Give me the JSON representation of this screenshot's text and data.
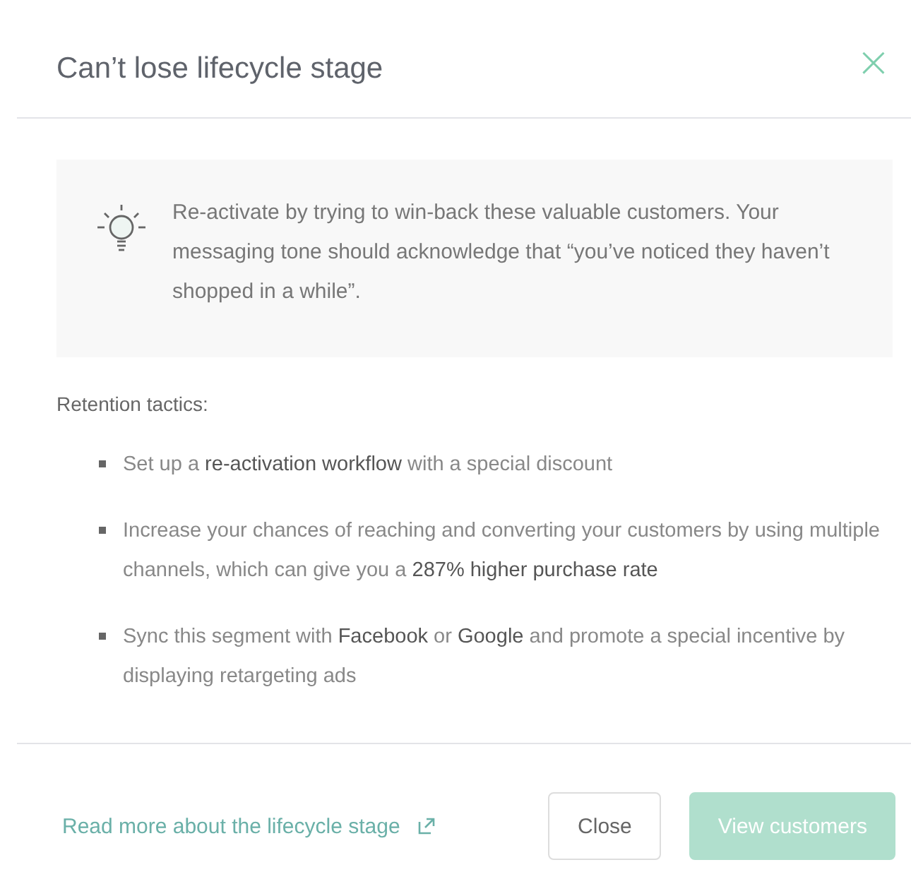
{
  "dialog": {
    "title": "Can’t lose lifecycle stage",
    "close_icon": "×"
  },
  "tip": {
    "text": "Re-activate by trying to win-back these valuable customers. Your messaging tone should acknowledge that “you’ve noticed they haven’t shopped in a while”."
  },
  "section_title": "Retention tactics:",
  "tactics": [
    {
      "text": "Set up a **re-activation workflow** with a special discount"
    },
    {
      "text": "Increase your chances of reaching and converting your customers by using multiple channels, which can give you a **287% higher purchase rate**"
    },
    {
      "text": "Sync this segment with **Facebook** or **Google** and promote a special incentive by displaying retargeting ads"
    }
  ],
  "footer": {
    "link": "Read more about the lifecycle stage",
    "buttons": [
      {
        "label": "Close",
        "kind": "secondary",
        "disabled": false
      },
      {
        "label": "View customers",
        "kind": "primary",
        "disabled": true
      }
    ]
  }
}
